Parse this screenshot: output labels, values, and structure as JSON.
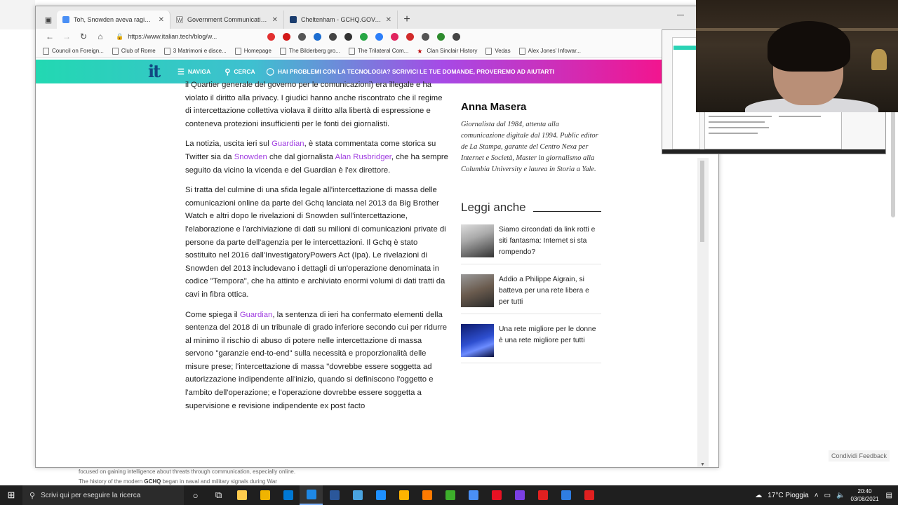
{
  "background": {
    "line1": "focused on gaining intelligence about threats through communication, especially online.",
    "line2_before": "The history of the modern ",
    "line2_bold": "GCHQ",
    "line2_after": " began in naval and military signals during War",
    "feedback": "Condividi Feedback"
  },
  "tabs": [
    {
      "title": "Toh, Snowden aveva ragione - It",
      "favicon_color": "#4a8ff5",
      "active": true
    },
    {
      "title": "Government Communications H",
      "favicon_label": "W",
      "favicon_color": "#444",
      "active": false
    },
    {
      "title": "Cheltenham - GCHQ.GOV.UK",
      "favicon_color": "#1b3d6e",
      "active": false
    }
  ],
  "toolbar": {
    "url": "https://www.italian.tech/blog/w...",
    "extension_colors": [
      "#e23030",
      "#d21818",
      "#555",
      "#1c6dd0",
      "#444",
      "#333",
      "#28a745",
      "#2d7ff9",
      "#e0245e",
      "#d12b2b",
      "#555",
      "#2e8b2e",
      "#444"
    ]
  },
  "bookmarks": [
    {
      "label": "Council on Foreign...",
      "icon": "page-icon"
    },
    {
      "label": "Club of Rome",
      "icon": "page-icon"
    },
    {
      "label": "3 Matrimoni e disce...",
      "icon": "page-icon"
    },
    {
      "label": "Homepage",
      "icon": "page-icon"
    },
    {
      "label": "The Bilderberg gro...",
      "icon": "page-icon"
    },
    {
      "label": "The Trilateral Com...",
      "icon": "page-icon"
    },
    {
      "label": "Clan Sinclair History",
      "icon": "star-icon"
    },
    {
      "label": "Vedas",
      "icon": "page-icon"
    },
    {
      "label": "Alex Jones' Infowar...",
      "icon": "page-icon"
    }
  ],
  "site": {
    "logo": "it",
    "nav": {
      "naviga": "NAVIGA",
      "cerca": "CERCA"
    },
    "promo": "HAI PROBLEMI CON LA TECNOLOGIA? SCRIVICI LE TUE DOMANDE, PROVEREMO AD AIUTARTI"
  },
  "article": {
    "p0": "il Quartier generale del governo per le comunicazioni) era illegale e ha violato il diritto alla privacy. I giudici hanno anche riscontrato che il regime di intercettazione collettiva violava il diritto alla libertà di espressione e conteneva protezioni insufficienti per le fonti dei giornalisti.",
    "p1a": "La notizia, uscita ieri sul ",
    "p1_link1": "Guardian",
    "p1b": ", è stata commentata come storica su Twitter sia da ",
    "p1_link2": "Snowden",
    "p1c": " che dal giornalista ",
    "p1_link3": "Alan Rusbridger",
    "p1d": ", che ha sempre seguito da vicino la vicenda e del Guardian è l'ex direttore.",
    "p2": "Si tratta del culmine di una sfida legale all'intercettazione di massa delle comunicazioni online da parte del Gchq lanciata nel 2013 da Big Brother Watch e altri dopo le rivelazioni di Snowden sull'intercettazione, l'elaborazione e l'archiviazione di dati su milioni di comunicazioni private di persone da parte dell'agenzia per le intercettazioni. Il Gchq è stato sostituito nel 2016 dall'InvestigatoryPowers Act (Ipa). Le rivelazioni di Snowden del 2013 includevano i dettagli di un'operazione denominata in codice \"Tempora\", che ha attinto e archiviato enormi volumi di dati tratti da cavi in fibra ottica.",
    "p3a": "Come spiega il ",
    "p3_link": "Guardian",
    "p3b": ", la sentenza di ieri ha confermato elementi della sentenza del 2018 di un tribunale di grado inferiore secondo cui per ridurre al minimo il rischio di abuso di potere nelle intercettazione di massa servono \"garanzie end-to-end\" sulla necessità e proporzionalità delle misure prese; l'intercettazione di massa \"dovrebbe essere soggetta ad autorizzazione indipendente all'inizio, quando si definiscono l'oggetto e l'ambito dell'operazione; e l'operazione dovrebbe essere soggetta a supervisione e revisione indipendente ex post facto"
  },
  "sidebar": {
    "author": "Anna Masera",
    "bio": "Giornalista dal 1984, attenta alla comunicazione digitale dal 1994. Public editor de La Stampa, garante del Centro Nexa per Internet e Società, Master in giornalismo alla Columbia University e laurea in Storia a Yale.",
    "leggi": "Leggi anche",
    "related": [
      {
        "title": "Siamo circondati da link rotti e siti fantasma: Internet si sta rompendo?"
      },
      {
        "title": "Addio a Philippe Aigrain, si batteva per una rete libera e per tutti"
      },
      {
        "title": "Una rete migliore per le donne è una rete migliore per tutti"
      }
    ]
  },
  "taskbar": {
    "search_placeholder": "Scrivi qui per eseguire la ricerca",
    "weather": "17°C Pioggia",
    "time": "20:40",
    "date": "03/08/2021",
    "app_colors": [
      "#ffcc4d",
      "#f0b400",
      "#0078d4",
      "#1e88e5",
      "#2b579a",
      "#4aa3df",
      "#1e90ff",
      "#ffb300",
      "#ff7a00",
      "#3dae2b",
      "#4a8ff5",
      "#e81123",
      "#7b3fe4",
      "#e02020",
      "#2f7de1",
      "#e02020"
    ]
  }
}
